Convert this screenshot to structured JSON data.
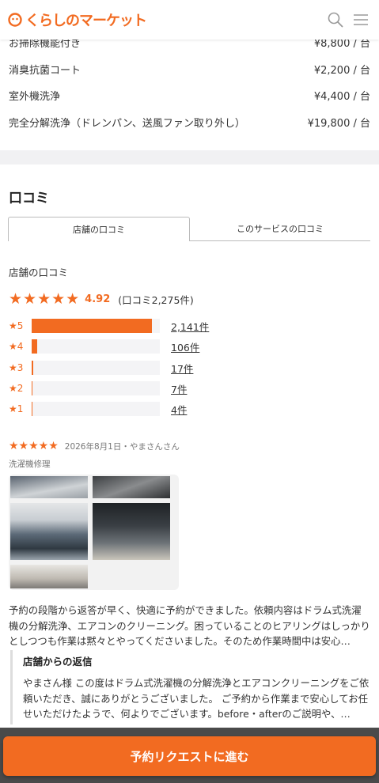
{
  "header": {
    "logo_text": "くらしのマーケット",
    "brand_color": "#f26b21"
  },
  "price_list": [
    {
      "name": "お掃除機能付き",
      "price": "¥8,800 / 台"
    },
    {
      "name": "消臭抗菌コート",
      "price": "¥2,200 / 台"
    },
    {
      "name": "室外機洗浄",
      "price": "¥4,400 / 台"
    },
    {
      "name": "完全分解洗浄（ドレンパン、送風ファン取り外し）",
      "price": "¥19,800 / 台"
    }
  ],
  "reviews": {
    "title": "口コミ",
    "tabs": [
      {
        "label": "店舗の口コミ",
        "active": true
      },
      {
        "label": "このサービスの口コミ",
        "active": false
      }
    ],
    "subhead": "店舗の口コミ",
    "summary": {
      "stars": "★★★★★",
      "score": "4.92",
      "count_text": "(口コミ2,275件)"
    },
    "distribution": [
      {
        "label": "★5",
        "count": "2,141件",
        "fraction": 0.94
      },
      {
        "label": "★4",
        "count": "106件",
        "fraction": 0.046
      },
      {
        "label": "★3",
        "count": "17件",
        "fraction": 0.01
      },
      {
        "label": "★2",
        "count": "7件",
        "fraction": 0.006
      },
      {
        "label": "★1",
        "count": "4件",
        "fraction": 0.006
      }
    ],
    "review": {
      "stars": "★★★★★",
      "date_user": "2026年8月1日・やまさんさん",
      "category": "洗濯機修理",
      "body": "予約の段階から返答が早く、快適に予約ができました。依頼内容はドラム式洗濯機の分解洗浄、エアコンのクリーニング。困っていることのヒアリングはしっかりとしつつも作業は黙々とやってくださいました。そのため作業時間中は安心…",
      "reply_title": "店舗からの返信",
      "reply_body": "やまさん様 この度はドラム式洗濯機の分解洗浄とエアコンクリーニングをご依頼いただき、誠にありがとうございました。 ご予約から作業まで安心してお任せいただけたようで、何よりでございます。before・afterのご説明や、…"
    }
  },
  "cta": {
    "label": "予約リクエストに進む"
  }
}
